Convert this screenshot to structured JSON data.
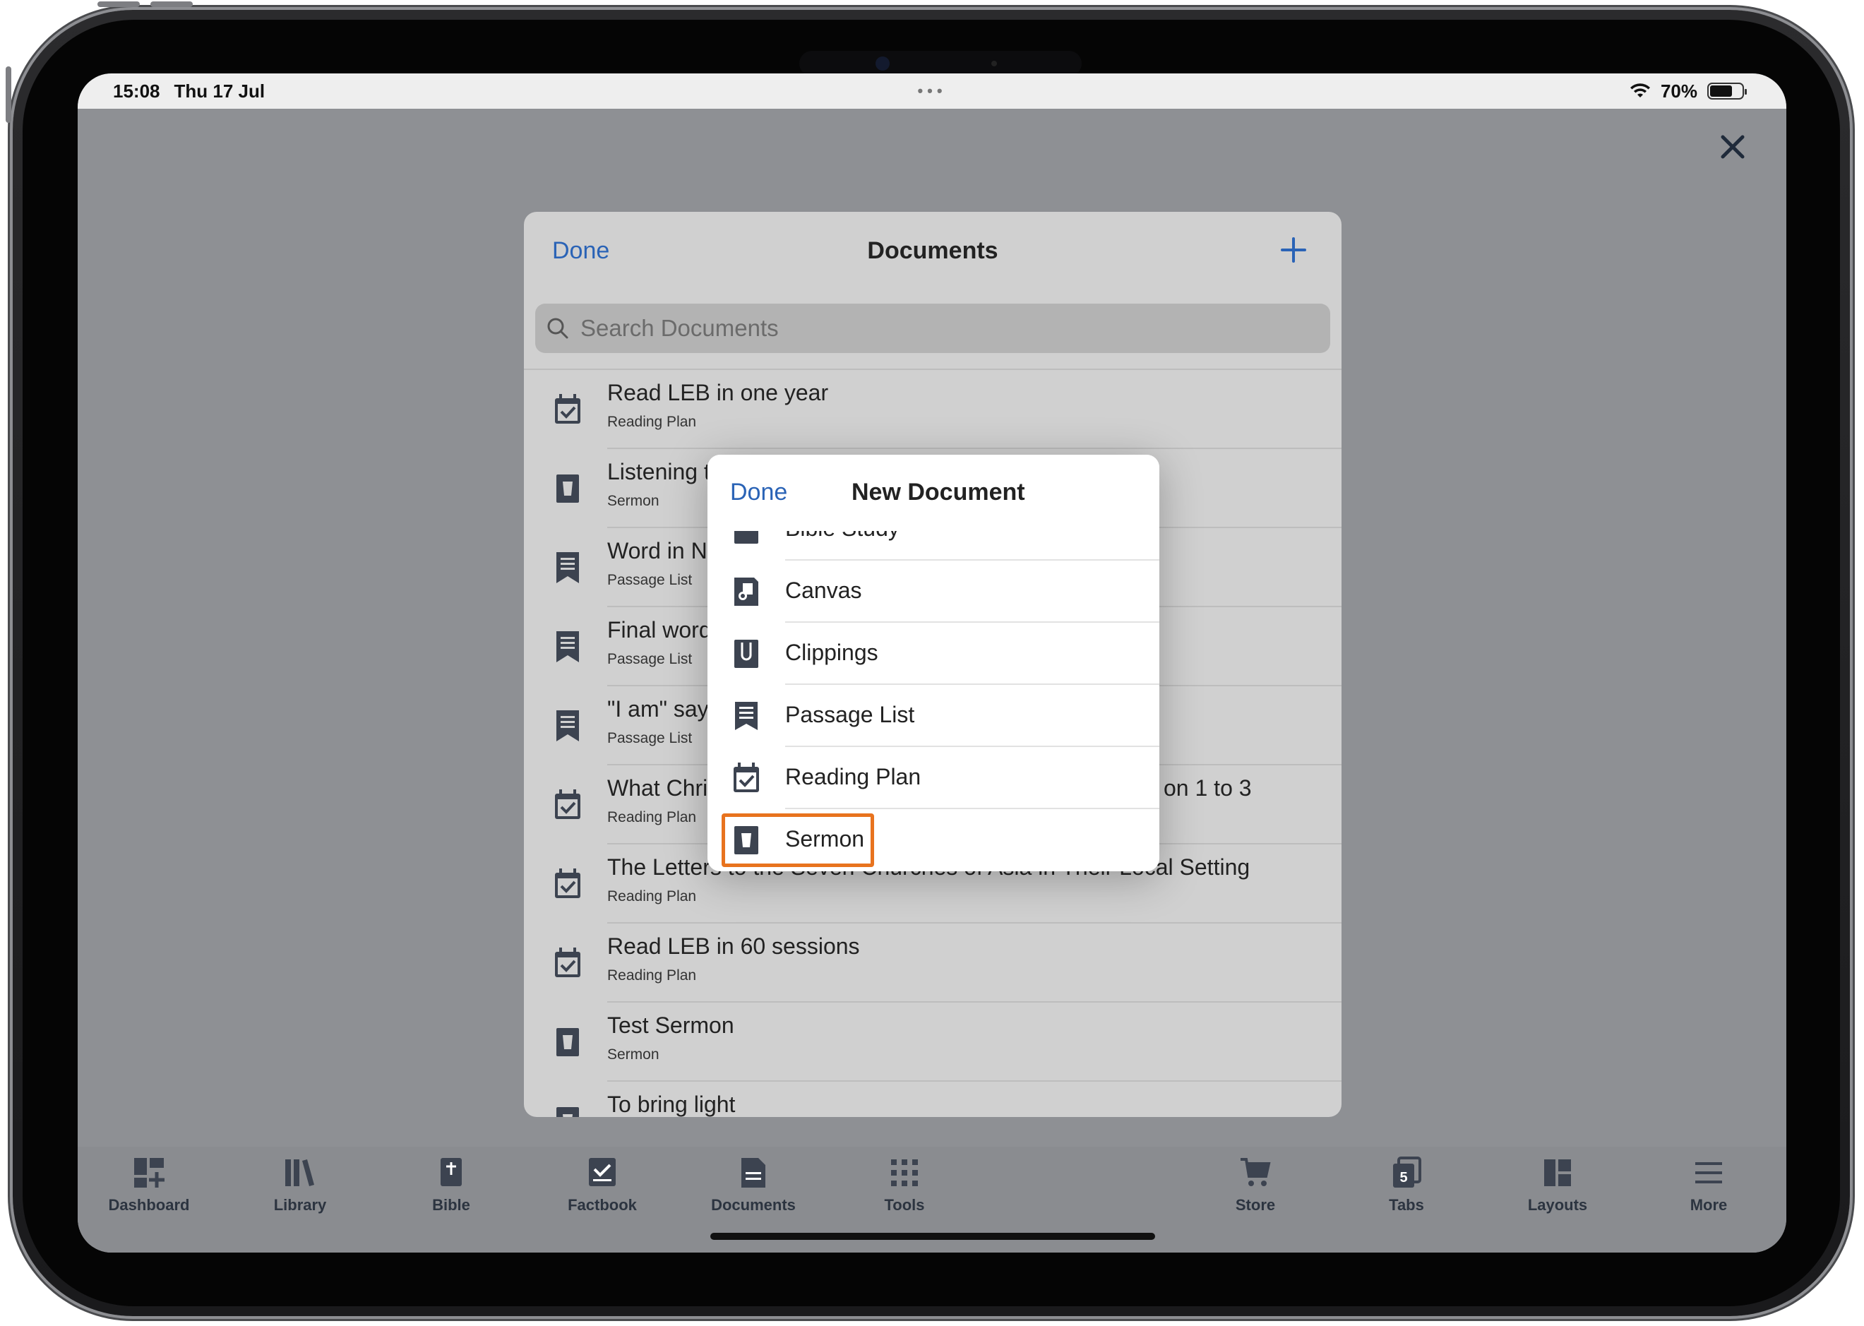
{
  "status_bar": {
    "time": "15:08",
    "date": "Thu 17 Jul",
    "dots": "•••",
    "battery": "70%",
    "battery_level": 0.7
  },
  "close_icon": "close-icon",
  "documents": {
    "done_label": "Done",
    "title": "Documents",
    "add_icon": "plus-icon",
    "search_placeholder": "Search Documents",
    "items": [
      {
        "title": "Read LEB in one year",
        "type": "Reading Plan",
        "icon": "reading-plan-icon"
      },
      {
        "title": "Listening t",
        "type": "Sermon",
        "icon": "sermon-icon"
      },
      {
        "title": "Word in Ne",
        "type": "Passage List",
        "icon": "passage-list-icon"
      },
      {
        "title": "Final word",
        "type": "Passage List",
        "icon": "passage-list-icon"
      },
      {
        "title": "\"I am\" sayi",
        "type": "Passage List",
        "icon": "passage-list-icon"
      },
      {
        "title": "What Chris",
        "title_right": "on 1 to 3",
        "type": "Reading Plan",
        "icon": "reading-plan-icon"
      },
      {
        "title": "The Letters to the Seven Churches of Asia in Their Local Setting",
        "type": "Reading Plan",
        "icon": "reading-plan-icon"
      },
      {
        "title": "Read LEB in 60 sessions",
        "type": "Reading Plan",
        "icon": "reading-plan-icon"
      },
      {
        "title": "Test Sermon",
        "type": "Sermon",
        "icon": "sermon-icon"
      },
      {
        "title": "To bring light",
        "type": "",
        "icon": "sermon-icon"
      }
    ]
  },
  "new_document": {
    "done_label": "Done",
    "title": "New Document",
    "items": [
      {
        "label": "Bible Study",
        "icon": "bible-study-icon"
      },
      {
        "label": "Canvas",
        "icon": "canvas-icon"
      },
      {
        "label": "Clippings",
        "icon": "clippings-icon"
      },
      {
        "label": "Passage List",
        "icon": "passage-list-icon"
      },
      {
        "label": "Reading Plan",
        "icon": "reading-plan-icon"
      },
      {
        "label": "Sermon",
        "icon": "sermon-icon"
      }
    ],
    "highlight_color": "#e8731e"
  },
  "tabbar": {
    "items": [
      {
        "label": "Dashboard",
        "icon": "dashboard-icon"
      },
      {
        "label": "Library",
        "icon": "library-icon"
      },
      {
        "label": "Bible",
        "icon": "bible-icon"
      },
      {
        "label": "Factbook",
        "icon": "factbook-icon"
      },
      {
        "label": "Documents",
        "icon": "documents-icon"
      },
      {
        "label": "Tools",
        "icon": "tools-icon"
      },
      {
        "label": "Store",
        "icon": "store-icon"
      },
      {
        "label": "Tabs",
        "icon": "tabs-icon",
        "badge": "5"
      },
      {
        "label": "Layouts",
        "icon": "layouts-icon"
      },
      {
        "label": "More",
        "icon": "more-icon"
      }
    ]
  },
  "colors": {
    "accent": "#2a63b6",
    "icon": "#3c4350",
    "highlight": "#e8731e"
  }
}
